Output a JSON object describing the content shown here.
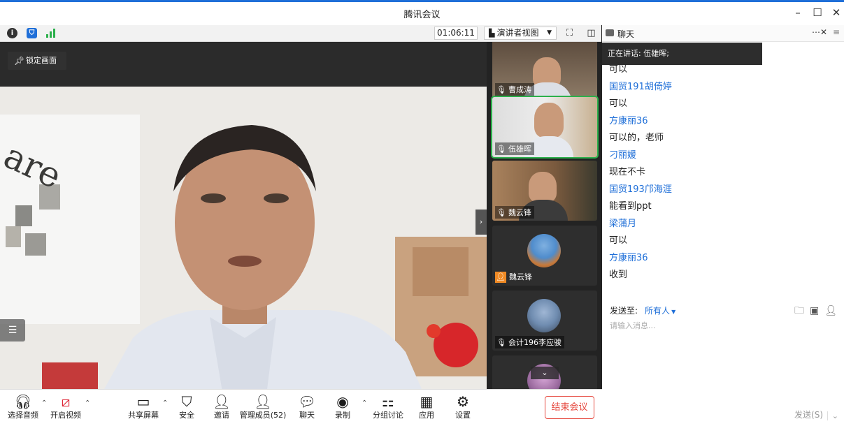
{
  "window": {
    "title": "腾讯会议"
  },
  "toolbar": {
    "timer": "01:06:11",
    "view_label": "演讲者视图"
  },
  "stage": {
    "lock_label": "锁定画面"
  },
  "participants": [
    {
      "name": "曹成涛",
      "type": "video",
      "active": false
    },
    {
      "name": "伍雄晖",
      "type": "video",
      "active": true
    },
    {
      "name": "魏云锋",
      "type": "video",
      "active": false
    },
    {
      "name": "魏云锋",
      "type": "avatar",
      "active": false
    },
    {
      "name": "会计196李应骏",
      "type": "avatar",
      "active": false
    },
    {
      "name": "",
      "type": "avatar",
      "active": false
    }
  ],
  "chat": {
    "title": "聊天",
    "speaking": "正在讲话: 伍雄晖;",
    "messages": [
      {
        "kind": "text",
        "value": "可以"
      },
      {
        "kind": "sender",
        "value": "国贸191胡倚婷"
      },
      {
        "kind": "text",
        "value": "可以"
      },
      {
        "kind": "sender",
        "value": "方康丽36"
      },
      {
        "kind": "text",
        "value": "可以的，老师"
      },
      {
        "kind": "sender",
        "value": "刁丽媛"
      },
      {
        "kind": "text",
        "value": "现在不卡"
      },
      {
        "kind": "sender",
        "value": "国贸193邝海涯"
      },
      {
        "kind": "text",
        "value": "能看到ppt"
      },
      {
        "kind": "sender",
        "value": "梁蒲月"
      },
      {
        "kind": "text",
        "value": "可以"
      },
      {
        "kind": "sender",
        "value": "方康丽36"
      },
      {
        "kind": "text",
        "value": "收到"
      }
    ],
    "send_to_label": "发送至:",
    "send_to_value": "所有人",
    "input_placeholder": "请输入消息...",
    "send_label": "发送(S)"
  },
  "bottom": {
    "audio": "选择音频",
    "video": "开启视频",
    "share": "共享屏幕",
    "security": "安全",
    "invite": "邀请",
    "members": "管理成员(52)",
    "chat": "聊天",
    "record": "录制",
    "breakout": "分组讨论",
    "apps": "应用",
    "settings": "设置",
    "end": "结束会议"
  }
}
